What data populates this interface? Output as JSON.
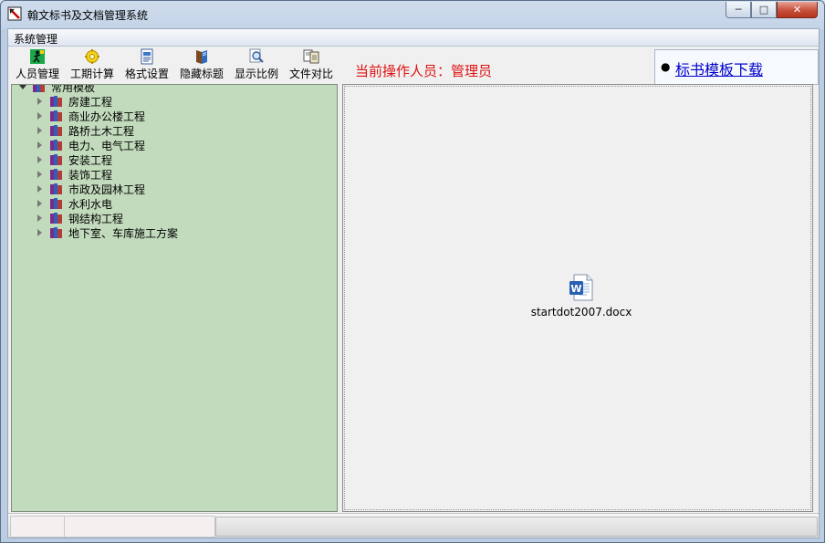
{
  "window": {
    "title": "翰文标书及文档管理系统",
    "controls": {
      "minimize": "─",
      "maximize": "□",
      "close": "✕"
    }
  },
  "menubar": {
    "items": [
      {
        "label": "系统管理"
      }
    ]
  },
  "toolbar": {
    "buttons": [
      {
        "label": "人员管理",
        "icon": "person-walk-icon"
      },
      {
        "label": "工期计算",
        "icon": "calculator-gear-icon"
      },
      {
        "label": "格式设置",
        "icon": "format-doc-icon"
      },
      {
        "label": "隐藏标题",
        "icon": "book-icon"
      },
      {
        "label": "显示比例",
        "icon": "magnifier-icon"
      },
      {
        "label": "文件对比",
        "icon": "compare-icon"
      }
    ]
  },
  "operator_label": "当前操作人员：管理员",
  "download_link": "标书模板下载",
  "tree": {
    "root": "常用模板",
    "items": [
      {
        "label": "房建工程"
      },
      {
        "label": "商业办公楼工程"
      },
      {
        "label": "路桥土木工程"
      },
      {
        "label": "电力、电气工程"
      },
      {
        "label": "安装工程"
      },
      {
        "label": "装饰工程"
      },
      {
        "label": "市政及园林工程"
      },
      {
        "label": "水利水电"
      },
      {
        "label": "钢结构工程"
      },
      {
        "label": "地下室、车库施工方案"
      }
    ]
  },
  "file_view": {
    "file": {
      "name": "startdot2007.docx",
      "icon": "word-document-icon"
    }
  },
  "colors": {
    "tree_background": "#c3dbbd",
    "operator_text": "#e01010",
    "link": "#0000cc"
  }
}
